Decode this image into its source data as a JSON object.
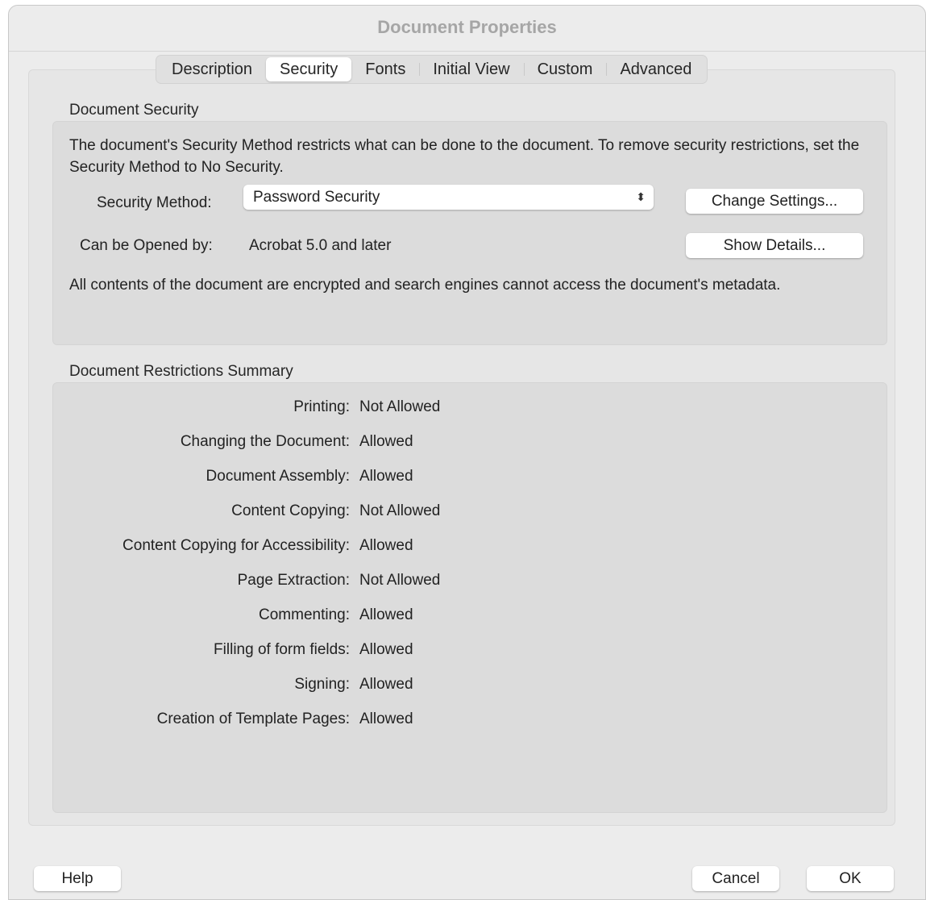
{
  "window": {
    "title": "Document Properties"
  },
  "tabs": [
    {
      "label": "Description",
      "active": false
    },
    {
      "label": "Security",
      "active": true
    },
    {
      "label": "Fonts",
      "active": false
    },
    {
      "label": "Initial View",
      "active": false
    },
    {
      "label": "Custom",
      "active": false
    },
    {
      "label": "Advanced",
      "active": false
    }
  ],
  "security": {
    "section_title": "Document Security",
    "intro": "The document's Security Method restricts what can be done to the document. To remove security restrictions, set the Security Method to No Security.",
    "method_label": "Security Method:",
    "method_value": "Password Security",
    "change_settings_label": "Change Settings...",
    "opened_by_label": "Can be Opened by:",
    "opened_by_value": "Acrobat 5.0 and later",
    "show_details_label": "Show Details...",
    "encryption_note": "All contents of the document are encrypted and search engines cannot access the document's metadata."
  },
  "restrictions": {
    "section_title": "Document Restrictions Summary",
    "rows": [
      {
        "label": "Printing:",
        "value": "Not Allowed"
      },
      {
        "label": "Changing the Document:",
        "value": "Allowed"
      },
      {
        "label": "Document Assembly:",
        "value": "Allowed"
      },
      {
        "label": "Content Copying:",
        "value": "Not Allowed"
      },
      {
        "label": "Content Copying for Accessibility:",
        "value": "Allowed"
      },
      {
        "label": "Page Extraction:",
        "value": "Not Allowed"
      },
      {
        "label": "Commenting:",
        "value": "Allowed"
      },
      {
        "label": "Filling of form fields:",
        "value": "Allowed"
      },
      {
        "label": "Signing:",
        "value": "Allowed"
      },
      {
        "label": "Creation of Template Pages:",
        "value": "Allowed"
      }
    ]
  },
  "footer": {
    "help_label": "Help",
    "cancel_label": "Cancel",
    "ok_label": "OK"
  }
}
